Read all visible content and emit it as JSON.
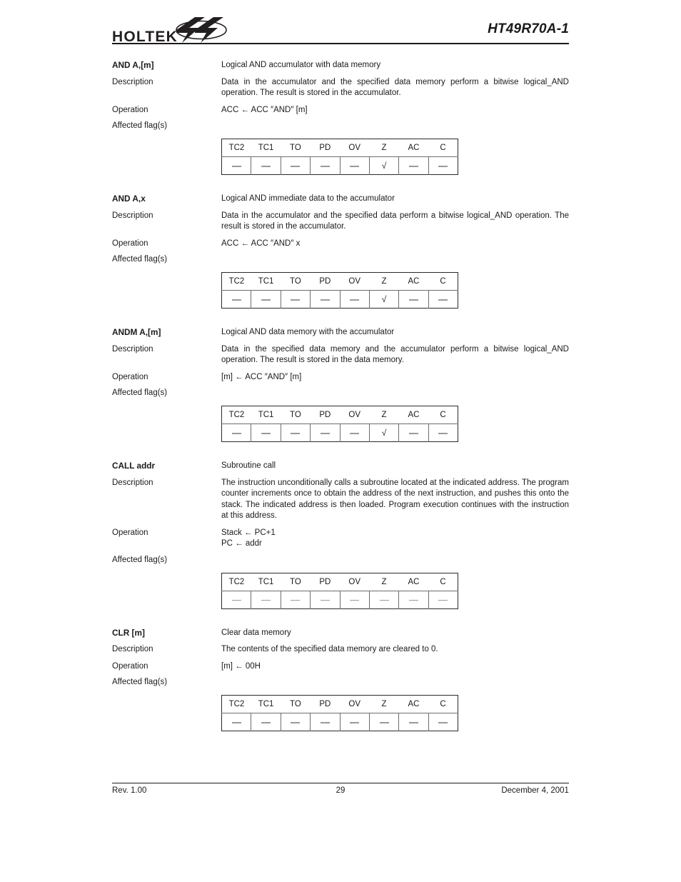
{
  "header": {
    "logo_text": "HOLTEK",
    "logo_mark_name": "holtek-lightning-mark",
    "doc_title": "HT49R70A-1"
  },
  "labels": {
    "description": "Description",
    "operation": "Operation",
    "affected_flags": "Affected flag(s)"
  },
  "flag_columns": [
    "TC2",
    "TC1",
    "TO",
    "PD",
    "OV",
    "Z",
    "AC",
    "C"
  ],
  "instructions": [
    {
      "mnemonic": "AND A,[m]",
      "summary": "Logical AND accumulator with data memory",
      "description": "Data in the accumulator and the specified data memory perform a bitwise logical_AND operation. The result is stored in the accumulator.",
      "operation_lines": [
        "ACC ← ACC ″AND″ [m]"
      ],
      "flags": [
        "—",
        "—",
        "—",
        "—",
        "—",
        "√",
        "—",
        "—"
      ]
    },
    {
      "mnemonic": "AND A,x",
      "summary": "Logical AND immediate data to the accumulator",
      "description": "Data in the accumulator and the specified data perform a bitwise logical_AND operation. The result is stored in the accumulator.",
      "operation_lines": [
        "ACC ← ACC ″AND″ x"
      ],
      "flags": [
        "—",
        "—",
        "—",
        "—",
        "—",
        "√",
        "—",
        "—"
      ]
    },
    {
      "mnemonic": "ANDM A,[m]",
      "summary": "Logical AND data memory with the accumulator",
      "description": "Data in the specified data memory and the accumulator perform a bitwise logical_AND operation. The result is stored in the data memory.",
      "operation_lines": [
        "[m] ← ACC ″AND″ [m]"
      ],
      "flags": [
        "—",
        "—",
        "—",
        "—",
        "—",
        "√",
        "—",
        "—"
      ]
    },
    {
      "mnemonic": "CALL addr",
      "summary": "Subroutine call",
      "description": "The instruction unconditionally calls a subroutine located at the indicated address. The program counter increments once to obtain the address of the next instruction, and pushes this onto the stack. The indicated address is then loaded. Program execution continues with the instruction at this address.",
      "operation_lines": [
        "Stack ← PC+1",
        "PC ← addr"
      ],
      "flags": [
        "—",
        "—",
        "—",
        "—",
        "—",
        "—",
        "—",
        "—"
      ]
    },
    {
      "mnemonic": "CLR [m]",
      "summary": "Clear data memory",
      "description": "The contents of the specified data memory are cleared to 0.",
      "operation_lines": [
        "[m] ← 00H"
      ],
      "flags": [
        "—",
        "—",
        "—",
        "—",
        "—",
        "—",
        "—",
        "—"
      ]
    }
  ],
  "footer": {
    "revision": "Rev. 1.00",
    "page_number": "29",
    "date": "December 4, 2001"
  }
}
